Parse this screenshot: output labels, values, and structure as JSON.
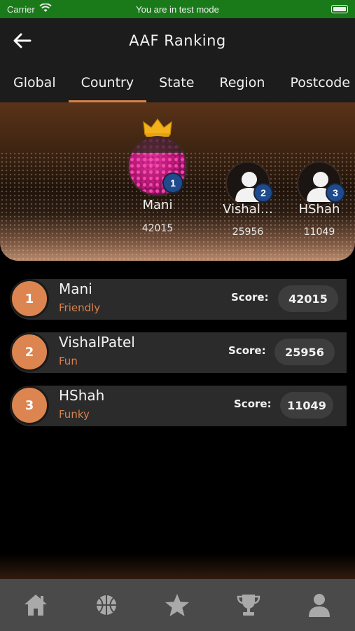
{
  "status_bar": {
    "carrier": "Carrier",
    "center_text": "You are in test mode"
  },
  "header": {
    "title": "AAF Ranking",
    "back_icon": "arrow-left-icon"
  },
  "tabs": [
    {
      "label": "Global",
      "active": false
    },
    {
      "label": "Country",
      "active": true
    },
    {
      "label": "State",
      "active": false
    },
    {
      "label": "Region",
      "active": false
    },
    {
      "label": "Postcode",
      "active": false
    }
  ],
  "podium": [
    {
      "rank": "1",
      "name": "Mani",
      "score": "42015",
      "avatar": "flowers-photo"
    },
    {
      "rank": "2",
      "name": "Vishal…",
      "score": "25956",
      "avatar": "person-icon"
    },
    {
      "rank": "3",
      "name": "HShah",
      "score": "11049",
      "avatar": "person-icon"
    }
  ],
  "leaderboard": {
    "score_label": "Score:",
    "rows": [
      {
        "rank": "1",
        "name": "Mani",
        "tag": "Friendly",
        "score": "42015"
      },
      {
        "rank": "2",
        "name": "VishalPatel",
        "tag": "Fun",
        "score": "25956"
      },
      {
        "rank": "3",
        "name": "HShah",
        "tag": "Funky",
        "score": "11049"
      }
    ]
  },
  "bottom_nav": [
    {
      "icon": "home-icon"
    },
    {
      "icon": "basketball-icon"
    },
    {
      "icon": "star-icon"
    },
    {
      "icon": "trophy-icon"
    },
    {
      "icon": "profile-icon"
    }
  ],
  "colors": {
    "accent": "#d8824f",
    "badge": "#1f4b8e",
    "status_bar": "#1a7a1a",
    "nav_bg": "#4a4a4a"
  }
}
